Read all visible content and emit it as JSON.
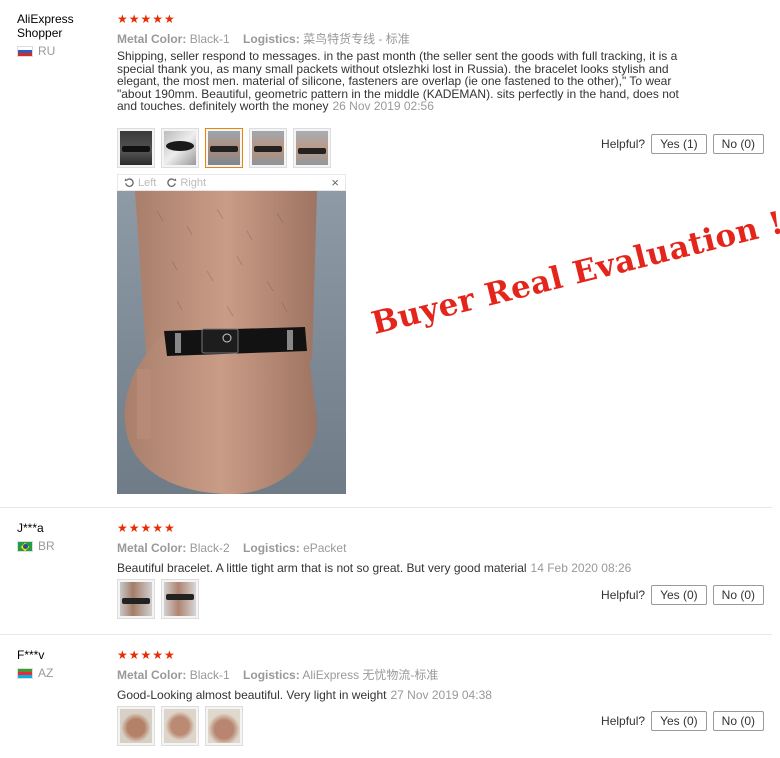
{
  "reviews": [
    {
      "user": "AliExpress Shopper",
      "country": "RU",
      "stars": "★★★★★",
      "metal_label": "Metal Color:",
      "metal_value": "Black-1",
      "logistics_label": "Logistics:",
      "logistics_value": "菜鸟特货专线 - 标准",
      "text": "Shipping, seller respond to messages. in the past month (the seller sent the goods with full tracking, it is a special thank you, as many small packets without otslezhki lost in Russia). the bracelet looks stylish and elegant, the most men. material of silicone, fasteners are overlap (ie one fastened to the other),\" To wear \"about 190mm. Beautiful, geometric pattern in the middle (KADEMAN). sits perfectly in the hand, does not and touches. definitely worth the money",
      "date": "26 Nov 2019 02:56",
      "helpful_label": "Helpful?",
      "yes": "Yes (1)",
      "no": "No (0)"
    },
    {
      "user": "J***a",
      "country": "BR",
      "stars": "★★★★★",
      "metal_label": "Metal Color:",
      "metal_value": "Black-2",
      "logistics_label": "Logistics:",
      "logistics_value": "ePacket",
      "text": "Beautiful bracelet. A little tight arm that is not so great. But very good material",
      "date": "14 Feb 2020 08:26",
      "helpful_label": "Helpful?",
      "yes": "Yes (0)",
      "no": "No (0)"
    },
    {
      "user": "F***v",
      "country": "AZ",
      "stars": "★★★★★",
      "metal_label": "Metal Color:",
      "metal_value": "Black-1",
      "logistics_label": "Logistics:",
      "logistics_value": "AliExpress 无忧物流-标准",
      "text": "Good-Looking almost beautiful. Very light in weight",
      "date": "27 Nov 2019 04:38",
      "helpful_label": "Helpful?",
      "yes": "Yes (0)",
      "no": "No (0)"
    }
  ],
  "viewer": {
    "left_label": "Left",
    "right_label": "Right",
    "close_glyph": "×"
  },
  "watermark": "Buyer Real Evaluation !",
  "colors": {
    "stars": "#e62e04",
    "watermark": "#e3251b",
    "active_thumb": "#e6860c"
  },
  "icons": [
    "rotate-left-icon",
    "rotate-right-icon",
    "close-icon"
  ]
}
